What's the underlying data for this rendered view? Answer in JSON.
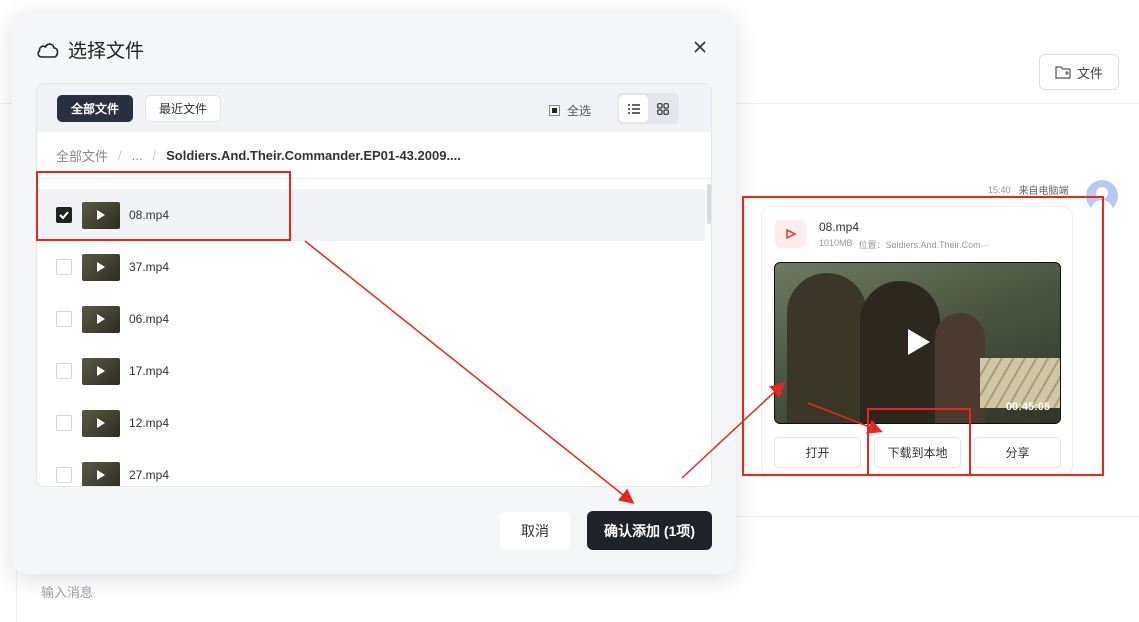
{
  "background": {
    "file_button_label": "文件",
    "input_placeholder": "输入消息",
    "message": {
      "time": "15:40",
      "source": "来自电脑端",
      "file_name": "08.mp4",
      "file_size": "1010MB",
      "location": "位置：Soldiers.And.Their.Com···",
      "video_duration": "00:45:05",
      "actions": [
        "打开",
        "下载到本地",
        "分享"
      ]
    }
  },
  "modal": {
    "title": "选择文件",
    "tabs": [
      {
        "label": "全部文件",
        "active": true
      },
      {
        "label": "最近文件",
        "active": false
      }
    ],
    "select_all_label": "全选",
    "breadcrumb": [
      "全部文件",
      "...",
      "Soldiers.And.Their.Commander.EP01-43.2009...."
    ],
    "files": [
      {
        "name": "08.mp4",
        "checked": true
      },
      {
        "name": "37.mp4",
        "checked": false
      },
      {
        "name": "06.mp4",
        "checked": false
      },
      {
        "name": "17.mp4",
        "checked": false
      },
      {
        "name": "12.mp4",
        "checked": false
      },
      {
        "name": "27.mp4",
        "checked": false
      }
    ],
    "cancel_label": "取消",
    "confirm_label": "确认添加 (1项)"
  },
  "colors": {
    "accent_dark": "#1f2229",
    "annotation_red": "#e8261d",
    "selected_row": "#f1f3f6"
  }
}
